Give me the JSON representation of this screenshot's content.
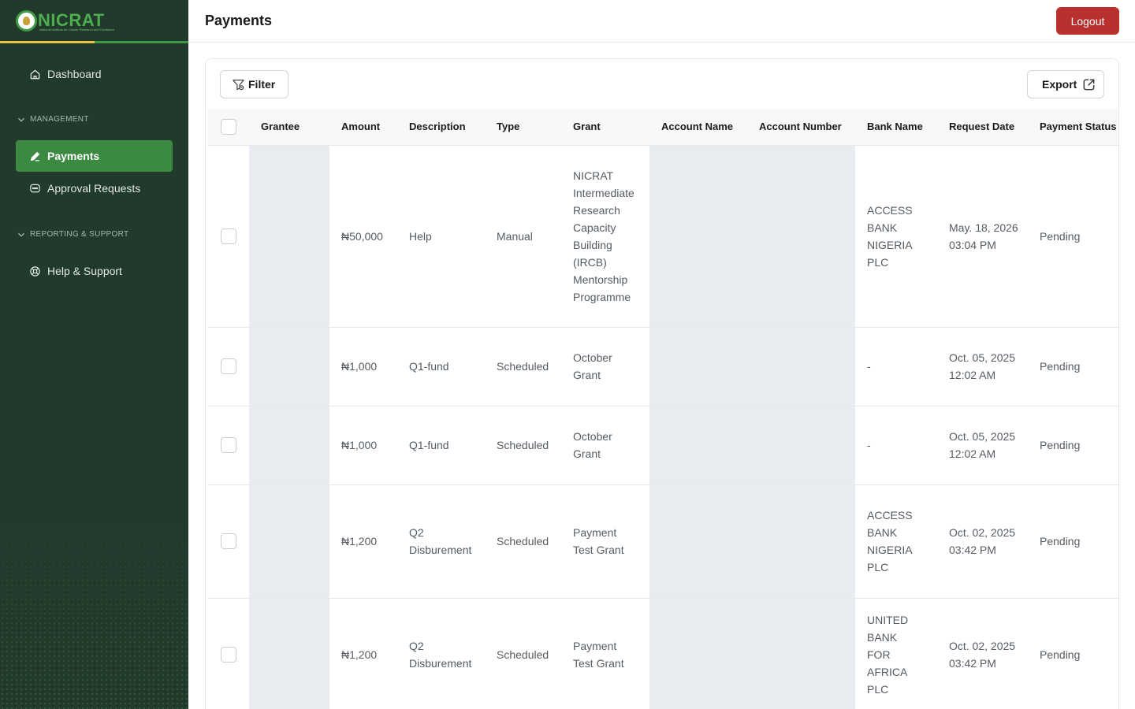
{
  "app": {
    "logo_text": "NICRAT",
    "logo_subtitle": "National Institute for Cancer Research and Treatment"
  },
  "sidebar": {
    "dashboard_label": "Dashboard",
    "section_management": "MANAGEMENT",
    "payments_label": "Payments",
    "approval_label": "Approval Requests",
    "section_reporting": "REPORTING & SUPPORT",
    "help_label": "Help & Support"
  },
  "header": {
    "title": "Payments",
    "logout_label": "Logout"
  },
  "toolbar": {
    "filter_label": "Filter",
    "export_label": "Export"
  },
  "table": {
    "columns": [
      "Grantee",
      "Amount",
      "Description",
      "Type",
      "Grant",
      "Account Name",
      "Account Number",
      "Bank Name",
      "Request Date",
      "Payment Status"
    ],
    "rows": [
      {
        "grantee": "",
        "amount": "₦50,000",
        "description": "Help",
        "type": "Manual",
        "grant": "NICRAT Intermediate Research Capacity Building (IRCB) Mentorship Programme",
        "account_name": "",
        "account_number": "",
        "bank_name": "ACCESS BANK NIGERIA PLC",
        "request_date": "May. 18, 2026 03:04 PM",
        "status": "Pending"
      },
      {
        "grantee": "",
        "amount": "₦1,000",
        "description": "Q1-fund",
        "type": "Scheduled",
        "grant": "October Grant",
        "account_name": "",
        "account_number": "",
        "bank_name": "-",
        "request_date": "Oct. 05, 2025 12:02 AM",
        "status": "Pending"
      },
      {
        "grantee": "",
        "amount": "₦1,000",
        "description": "Q1-fund",
        "type": "Scheduled",
        "grant": "October Grant",
        "account_name": "",
        "account_number": "",
        "bank_name": "-",
        "request_date": "Oct. 05, 2025 12:02 AM",
        "status": "Pending"
      },
      {
        "grantee": "",
        "amount": "₦1,200",
        "description": "Q2 Disburement",
        "type": "Scheduled",
        "grant": "Payment Test Grant",
        "account_name": "",
        "account_number": "",
        "bank_name": "ACCESS BANK NIGERIA PLC",
        "request_date": "Oct. 02, 2025 03:42 PM",
        "status": "Pending"
      },
      {
        "grantee": "",
        "amount": "₦1,200",
        "description": "Q2 Disburement",
        "type": "Scheduled",
        "grant": "Payment Test Grant",
        "account_name": "",
        "account_number": "",
        "bank_name": "UNITED BANK FOR AFRICA PLC",
        "request_date": "Oct. 02, 2025 03:42 PM",
        "status": "Pending"
      }
    ]
  },
  "colors": {
    "sidebar_bg": "#223a2b",
    "active_item": "#3c8a42",
    "logout": "#b8312f",
    "accent_yellow": "#e7c44a"
  },
  "icons": {
    "dashboard": "home-icon",
    "payments": "pen-icon",
    "approval": "chat-icon",
    "help": "support-icon",
    "filter": "filter-icon",
    "export": "external-link-icon"
  }
}
